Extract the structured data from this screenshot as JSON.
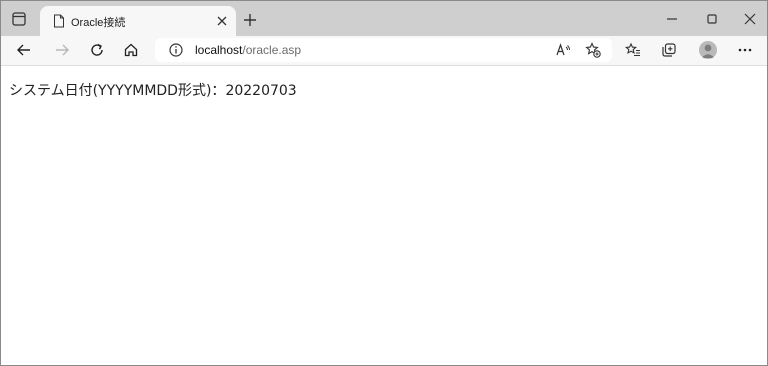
{
  "browser": {
    "tab": {
      "title": "Oracle接続"
    },
    "address_bar": {
      "host": "localhost",
      "path": "/oracle.asp"
    }
  },
  "page": {
    "label": "システム日付(YYYYMMDD形式)：",
    "value": "20220703"
  },
  "icons": {
    "tab_actions": "tab-actions-icon",
    "page": "page-icon",
    "close": "close-icon",
    "new_tab": "plus-icon",
    "minimize": "minimize-icon",
    "maximize": "maximize-icon",
    "window_close": "close-icon",
    "back": "back-arrow-icon",
    "forward": "forward-arrow-icon",
    "refresh": "refresh-icon",
    "home": "home-icon",
    "site_info": "info-icon",
    "read_aloud": "read-aloud-icon",
    "add_favorite": "add-favorite-icon",
    "favorites": "favorites-icon",
    "collections": "collections-icon",
    "profile": "avatar",
    "more": "more-icon"
  },
  "colors": {
    "tab_strip": "#cfcfcf",
    "toolbar": "#f7f7f7",
    "text": "#222222"
  }
}
